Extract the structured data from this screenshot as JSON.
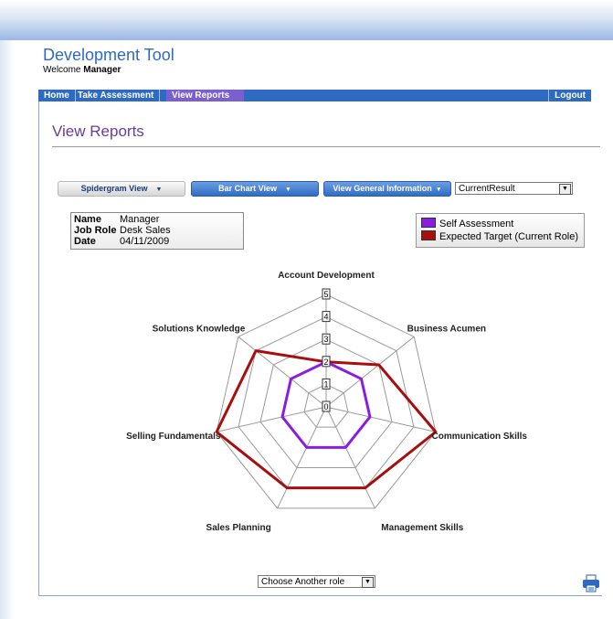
{
  "app": {
    "title": "Development Tool",
    "welcome_prefix": "Welcome",
    "welcome_user": "Manager"
  },
  "nav": {
    "items": [
      {
        "label": "Home"
      },
      {
        "label": "Take Assessment"
      },
      {
        "label": "View Reports"
      }
    ],
    "logout": "Logout"
  },
  "page": {
    "title": "View Reports"
  },
  "toolbar": {
    "spidergram_label": "Spidergram View",
    "barchart_label": "Bar Chart View",
    "general_info_label": "View General Information",
    "result_select": "CurrentResult",
    "choose_role": "Choose Another role"
  },
  "profile": {
    "rows": [
      {
        "key": "Name",
        "value": "Manager"
      },
      {
        "key": "Job Role",
        "value": "Desk Sales"
      },
      {
        "key": "Date",
        "value": "04/11/2009"
      }
    ]
  },
  "chart_data": {
    "type": "radar",
    "axes": [
      "Account Development",
      "Business Acumen",
      "Communication Skills",
      "Management Skills",
      "Sales Planning",
      "Selling Fundamentals",
      "Solutions Knowledge"
    ],
    "scale": {
      "min": 0,
      "max": 5,
      "ticks": [
        0,
        1,
        2,
        3,
        4,
        5
      ]
    },
    "series": [
      {
        "name": "Self Assessment",
        "color": "#8a1de0",
        "values": [
          2,
          2,
          2,
          2,
          2,
          2,
          2
        ]
      },
      {
        "name": "Expected Target (Current Role)",
        "color": "#a80e0e",
        "values": [
          2,
          3,
          5,
          4,
          4,
          5,
          4
        ]
      }
    ]
  },
  "icons": {
    "print": "printer-icon"
  }
}
